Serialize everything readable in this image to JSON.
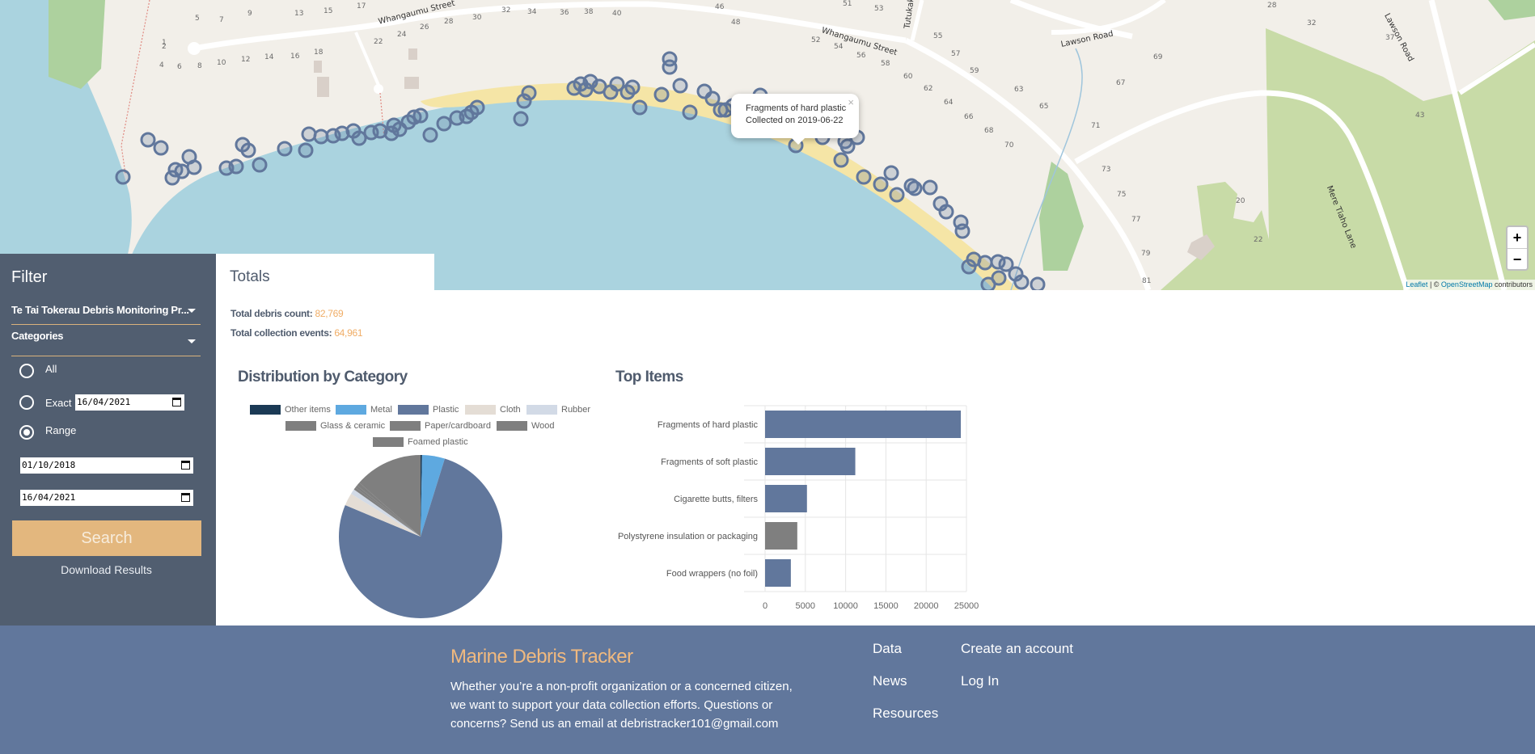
{
  "map": {
    "street_labels": [
      "Whangaumu Street",
      "Whangaumu Street",
      "Lawson Road",
      "Lawson Road",
      "Mere Tiaho Lane",
      "Tutukaka"
    ],
    "house_numbers": [
      {
        "t": "5"
      },
      {
        "t": "7"
      },
      {
        "t": "9"
      },
      {
        "t": "13"
      },
      {
        "t": "15"
      },
      {
        "t": "17"
      },
      {
        "t": "1"
      },
      {
        "t": "2"
      },
      {
        "t": "4"
      },
      {
        "t": "6"
      },
      {
        "t": "8"
      },
      {
        "t": "10"
      },
      {
        "t": "12"
      },
      {
        "t": "14"
      },
      {
        "t": "16"
      },
      {
        "t": "18"
      },
      {
        "t": "22"
      },
      {
        "t": "24"
      },
      {
        "t": "26"
      },
      {
        "t": "28"
      },
      {
        "t": "30"
      },
      {
        "t": "32"
      },
      {
        "t": "34"
      },
      {
        "t": "36"
      },
      {
        "t": "38"
      },
      {
        "t": "40"
      },
      {
        "t": "46"
      },
      {
        "t": "48"
      },
      {
        "t": "51"
      },
      {
        "t": "53"
      },
      {
        "t": "52"
      },
      {
        "t": "54"
      },
      {
        "t": "56"
      },
      {
        "t": "58"
      },
      {
        "t": "60"
      },
      {
        "t": "62"
      },
      {
        "t": "64"
      },
      {
        "t": "66"
      },
      {
        "t": "68"
      },
      {
        "t": "70"
      },
      {
        "t": "55"
      },
      {
        "t": "57"
      },
      {
        "t": "59"
      },
      {
        "t": "63"
      },
      {
        "t": "65"
      },
      {
        "t": "67"
      },
      {
        "t": "69"
      },
      {
        "t": "71"
      },
      {
        "t": "73"
      },
      {
        "t": "75"
      },
      {
        "t": "77"
      },
      {
        "t": "79"
      },
      {
        "t": "81"
      },
      {
        "t": "20"
      },
      {
        "t": "22"
      },
      {
        "t": "28"
      },
      {
        "t": "32"
      },
      {
        "t": "37"
      },
      {
        "t": "43"
      }
    ],
    "popup": {
      "line1": "Fragments of hard plastic",
      "line2": "Collected on 2019-06-22",
      "close": "×"
    },
    "zoom_in": "+",
    "zoom_out": "−",
    "attribution": {
      "leaflet": "Leaflet",
      "sep": " | © ",
      "osm": "OpenStreetMap",
      "suffix": " contributors"
    }
  },
  "sidebar": {
    "title": "Filter",
    "project_select": "Te Tai Tokerau Debris Monitoring Pr...",
    "categories_select": "Categories",
    "radio_all": "All",
    "radio_exact": "Exact",
    "exact_date": "16/04/2021",
    "radio_range": "Range",
    "selected_radio": "range",
    "range_start": "01/10/2018",
    "range_end": "16/04/2021",
    "search_button": "Search",
    "download_link": "Download Results"
  },
  "totals": {
    "tab_label": "Totals",
    "debris_label": "Total debris count: ",
    "debris_value": "82,769",
    "events_label": "Total collection events: ",
    "events_value": "64,961"
  },
  "distribution_title": "Distribution by Category",
  "top_items_title": "Top Items",
  "chart_data": [
    {
      "type": "pie",
      "title": "Distribution by Category",
      "legend_position": "top",
      "labels": [
        "Other items",
        "Metal",
        "Plastic",
        "Cloth",
        "Rubber",
        "Glass & ceramic",
        "Paper/cardboard",
        "Wood",
        "Foamed plastic"
      ],
      "colors": [
        "#1b3a55",
        "#5ea9e0",
        "#61779c",
        "#e4ddd5",
        "#d2dae6",
        "#7f7f7f",
        "#7f7f7f",
        "#7f7f7f",
        "#7f7f7f"
      ],
      "values": [
        0.3,
        4.5,
        76.5,
        2.5,
        1.0,
        0.5,
        0.5,
        0.7,
        13.5
      ]
    },
    {
      "type": "bar",
      "orientation": "horizontal",
      "title": "Top Items",
      "categories": [
        "Fragments of hard plastic",
        "Fragments of soft plastic",
        "Cigarette butts, filters",
        "Polystyrene insulation or packaging",
        "Food wrappers (no foil)"
      ],
      "values": [
        24300,
        11200,
        5200,
        4000,
        3200
      ],
      "colors": [
        "#61779c",
        "#61779c",
        "#61779c",
        "#7f7f7f",
        "#61779c"
      ],
      "xlim": [
        0,
        25000
      ],
      "xticks": [
        "0",
        "5000",
        "10000",
        "15000",
        "20000",
        "25000"
      ],
      "grid": true,
      "xlabel": "",
      "ylabel": ""
    }
  ],
  "footer": {
    "brand": "Marine Debris Tracker",
    "text": "Whether you’re a non-profit organization or a concerned citizen, we want to support your data collection efforts. Questions or concerns? Send us an email at debristracker101@gmail.com",
    "links_col1": [
      "Data",
      "News",
      "Resources"
    ],
    "links_col2": [
      "Create an account",
      "Log In"
    ]
  }
}
